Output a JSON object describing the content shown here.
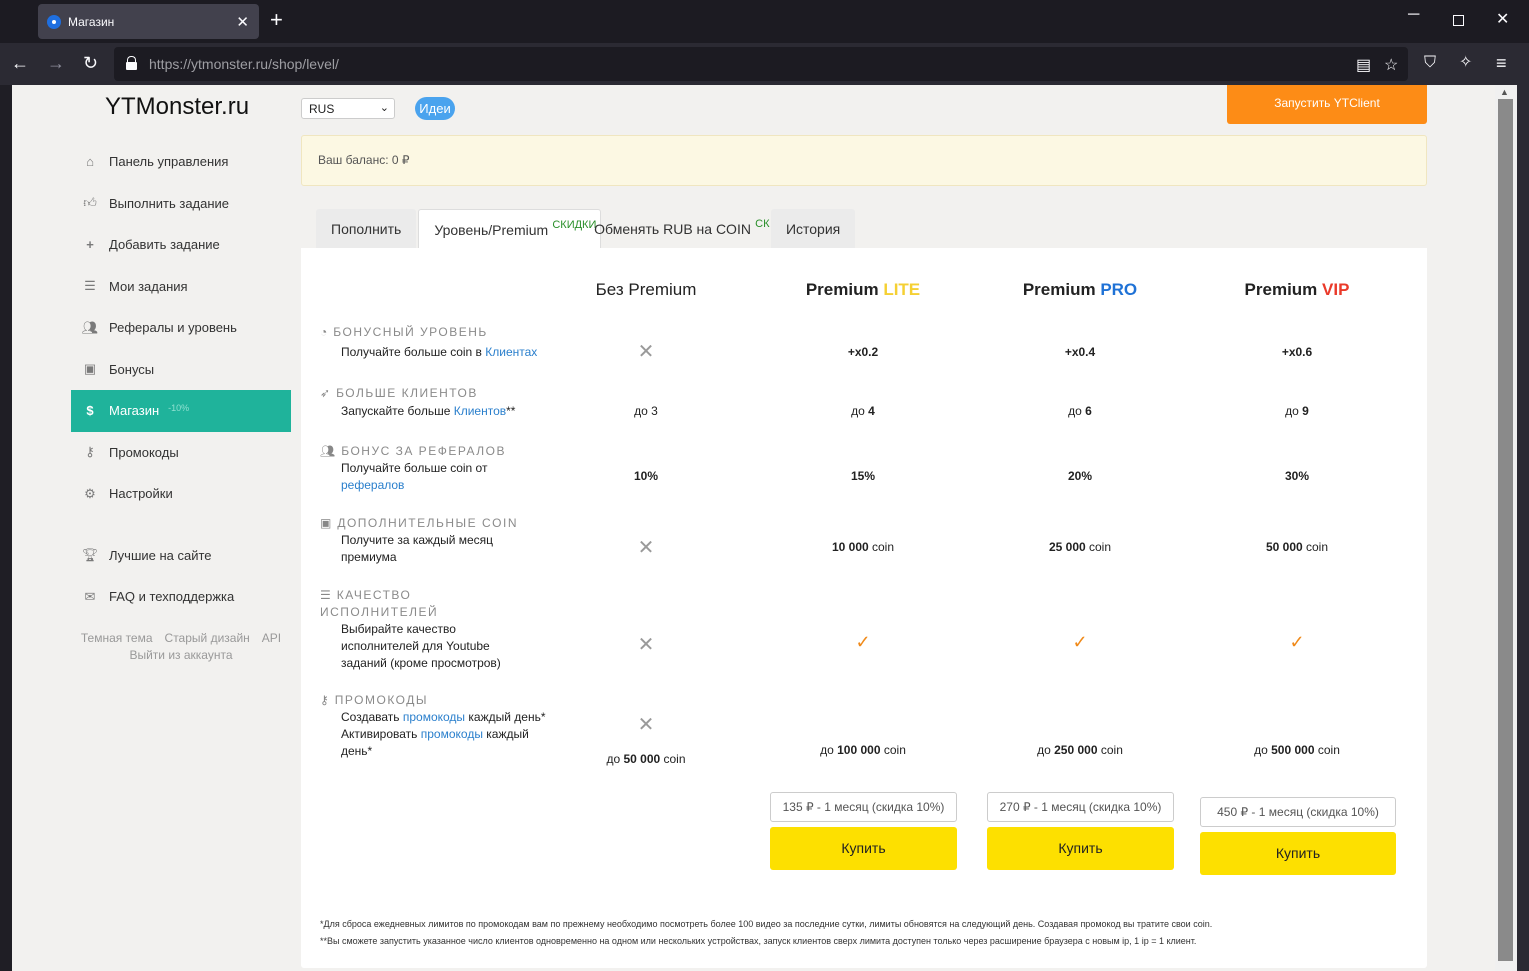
{
  "browser": {
    "tab_title": "Магазин",
    "url_host": "https://ytmonster.ru",
    "url_path": "/shop/level/"
  },
  "header": {
    "logo": "YTMonster.ru",
    "lang": "RUS",
    "ideas": "Идеи",
    "run_client": "Запустить YTClient",
    "balance": "Ваш баланс: 0 ₽"
  },
  "sidebar": {
    "items": [
      {
        "label": "Панель управления",
        "icon": "home-icon"
      },
      {
        "label": "Выполнить задание",
        "icon": "thumbs-up-icon"
      },
      {
        "label": "Добавить задание",
        "icon": "plus-icon"
      },
      {
        "label": "Мои задания",
        "icon": "list-icon"
      },
      {
        "label": "Рефералы и уровень",
        "icon": "users-icon"
      },
      {
        "label": "Бонусы",
        "icon": "gift-icon"
      },
      {
        "label": "Магазин",
        "icon": "dollar-icon",
        "badge": "-10%"
      },
      {
        "label": "Промокоды",
        "icon": "key-icon"
      },
      {
        "label": "Настройки",
        "icon": "gear-icon"
      }
    ],
    "items2": [
      {
        "label": "Лучшие на сайте",
        "icon": "trophy-icon"
      },
      {
        "label": "FAQ и техподдержка",
        "icon": "envelope-icon"
      }
    ],
    "footer": {
      "dark": "Темная тема",
      "old": "Старый дизайн",
      "api": "API",
      "logout": "Выйти из аккаунта"
    }
  },
  "tabs": {
    "topup": "Пополнить",
    "level": "Уровень/Premium",
    "level_badge": "СКИДКИ",
    "exchange": "Обменять RUB на COIN",
    "exchange_badge": "СК",
    "history": "История"
  },
  "plans": {
    "none": "Без Premium",
    "lite_prefix": "Premium ",
    "lite": "LITE",
    "pro_prefix": "Premium ",
    "pro": "PRO",
    "vip_prefix": "Premium ",
    "vip": "VIP"
  },
  "colors": {
    "lite": "#f5d033",
    "pro": "#1f72d6",
    "vip": "#ea3a2a",
    "accent": "#1fb39b",
    "orange": "#fd8c16",
    "yellow": "#fde000"
  },
  "rows": {
    "bonus": {
      "title": "Бонусный уровень",
      "desc1": "Получайте больше coin в ",
      "link": "Клиентах",
      "lite": "+x0.2",
      "pro": "+x0.4",
      "vip": "+x0.6"
    },
    "clients": {
      "title": "Больше клиентов",
      "desc1": "Запускайте больше ",
      "link": "Клиентов",
      "desc2": "**",
      "none": "до 3",
      "lite_pre": "до ",
      "lite": "4",
      "pro_pre": "до ",
      "pro": "6",
      "vip_pre": "до ",
      "vip": "9"
    },
    "referrals": {
      "title": "Бонус за рефералов",
      "desc1": "Получайте больше coin от",
      "link": "рефералов",
      "none": "10%",
      "lite": "15%",
      "pro": "20%",
      "vip": "30%"
    },
    "coins": {
      "title": "Дополнительные coin",
      "desc": "Получите за каждый месяц премиума",
      "lite": "10 000",
      "pro": "25 000",
      "vip": "50 000",
      "unit": " coin"
    },
    "quality": {
      "title1": "Качество",
      "title2": "исполнителей",
      "desc": "Выбирайте качество исполнителей для Youtube заданий (кроме просмотров)"
    },
    "promo": {
      "title": "Промокоды",
      "d1": "Создавать ",
      "link": "промокоды",
      "d2": " каждый день*",
      "d3": "Активировать ",
      "d4": " каждый день*",
      "none": "50 000",
      "lite": "100 000",
      "pro": "250 000",
      "vip": "500 000",
      "pre": "до ",
      "unit": " coin"
    }
  },
  "buy": {
    "lite_price": "135 ₽ - 1 месяц (скидка 10%)",
    "pro_price": "270 ₽ - 1 месяц (скидка 10%)",
    "vip_price": "450 ₽ - 1 месяц (скидка 10%)",
    "label": "Купить"
  },
  "footnotes": {
    "f1": "*Для сброса ежедневных лимитов по промокодам вам по прежнему необходимо посмотреть более 100 видео за последние сутки, лимиты обновятся на следующий день. Создавая промокод вы тратите свои coin.",
    "f2": "**Вы сможете запустить указанное число клиентов одновременно на одном или нескольких устройствах, запуск клиентов сверх лимита доступен только через расширение браузера с новым ip, 1 ip = 1 клиент."
  }
}
